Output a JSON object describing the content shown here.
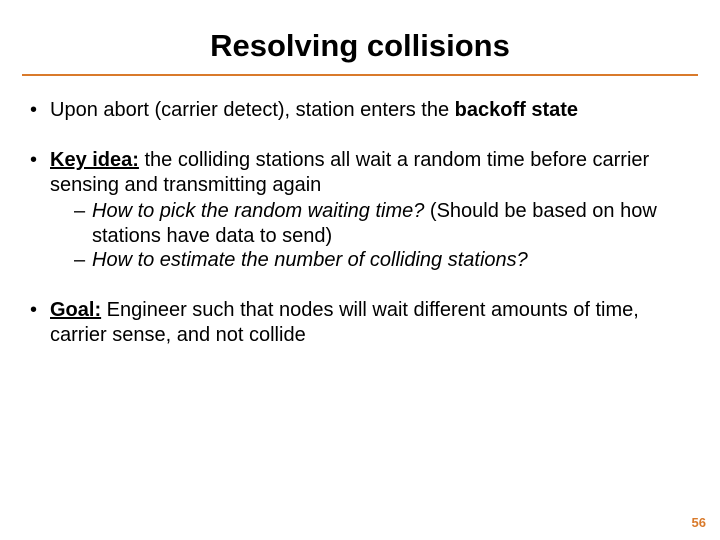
{
  "title": "Resolving collisions",
  "bullets": {
    "b1": {
      "pre": "Upon abort (carrier detect), station enters the ",
      "bold": "backoff state"
    },
    "b2": {
      "label": "Key idea:",
      "rest": " the colliding stations all wait a random time before carrier sensing and transmitting again",
      "sub1a": "How to pick the random waiting time?",
      "sub1b": "  (Should be based on how stations have data to send)",
      "sub2": "How to estimate the number of colliding stations?"
    },
    "b3": {
      "label": "Goal:",
      "rest": " Engineer such that nodes will wait different amounts of time, carrier sense, and not collide"
    }
  },
  "page_number": "56"
}
